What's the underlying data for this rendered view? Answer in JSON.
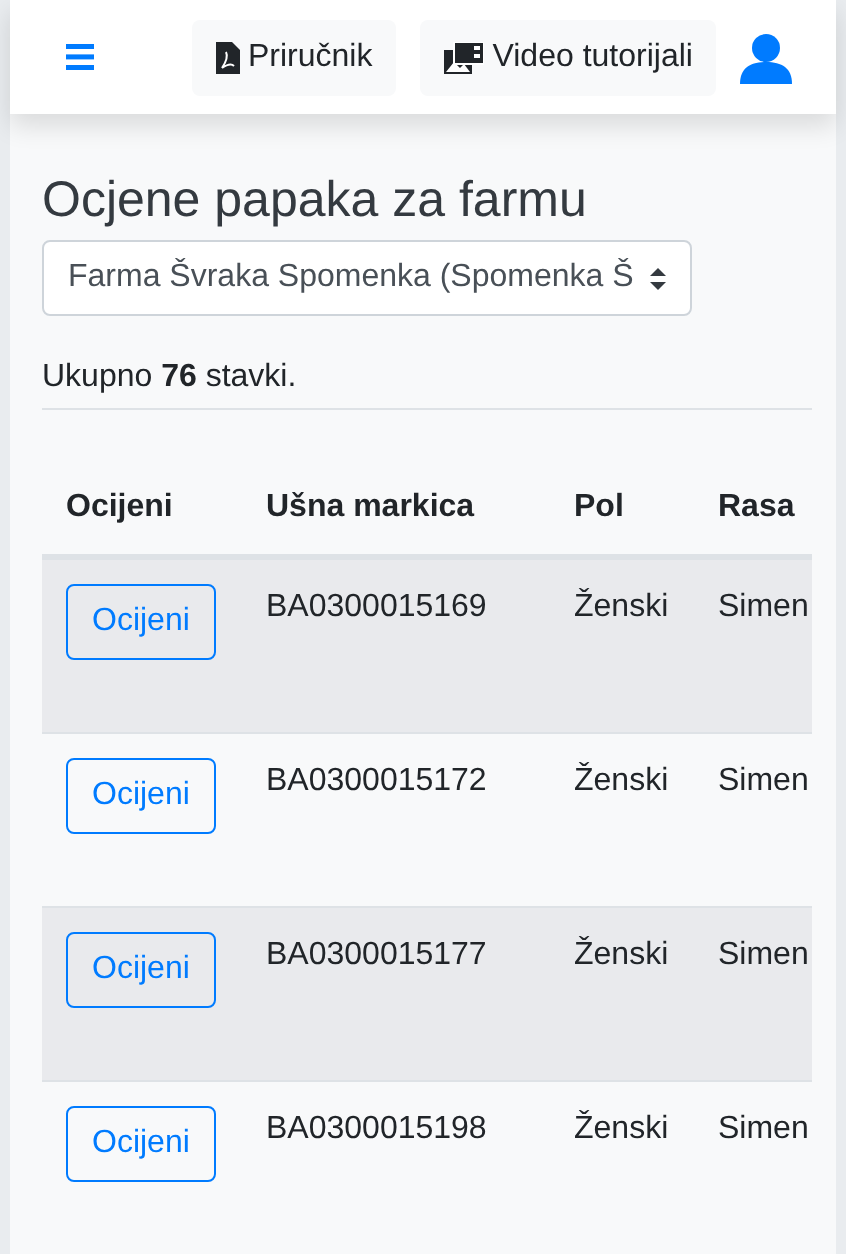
{
  "header": {
    "buttons": [
      {
        "kind": "pdf",
        "label": "Priručnik"
      },
      {
        "kind": "video",
        "label": "Video tutorijali"
      }
    ]
  },
  "title": "Ocjene papaka za farmu",
  "farm_select": {
    "value": "Farma Švraka Spomenka (Spomenka Š"
  },
  "summary": {
    "text": "Ukupno **76** stavki."
  },
  "table": {
    "columns": [
      "Ocijeni",
      "Ušna markica",
      "Pol",
      "Rasa"
    ],
    "rows": [
      {
        "action": "Ocijeni",
        "tag": "BA0300015169",
        "sex": "Ženski",
        "breed": "Simen"
      },
      {
        "action": "Ocijeni",
        "tag": "BA0300015172",
        "sex": "Ženski",
        "breed": "Simen"
      },
      {
        "action": "Ocijeni",
        "tag": "BA0300015177",
        "sex": "Ženski",
        "breed": "Simen"
      },
      {
        "action": "Ocijeni",
        "tag": "BA0300015198",
        "sex": "Ženski",
        "breed": "Simen"
      }
    ]
  }
}
